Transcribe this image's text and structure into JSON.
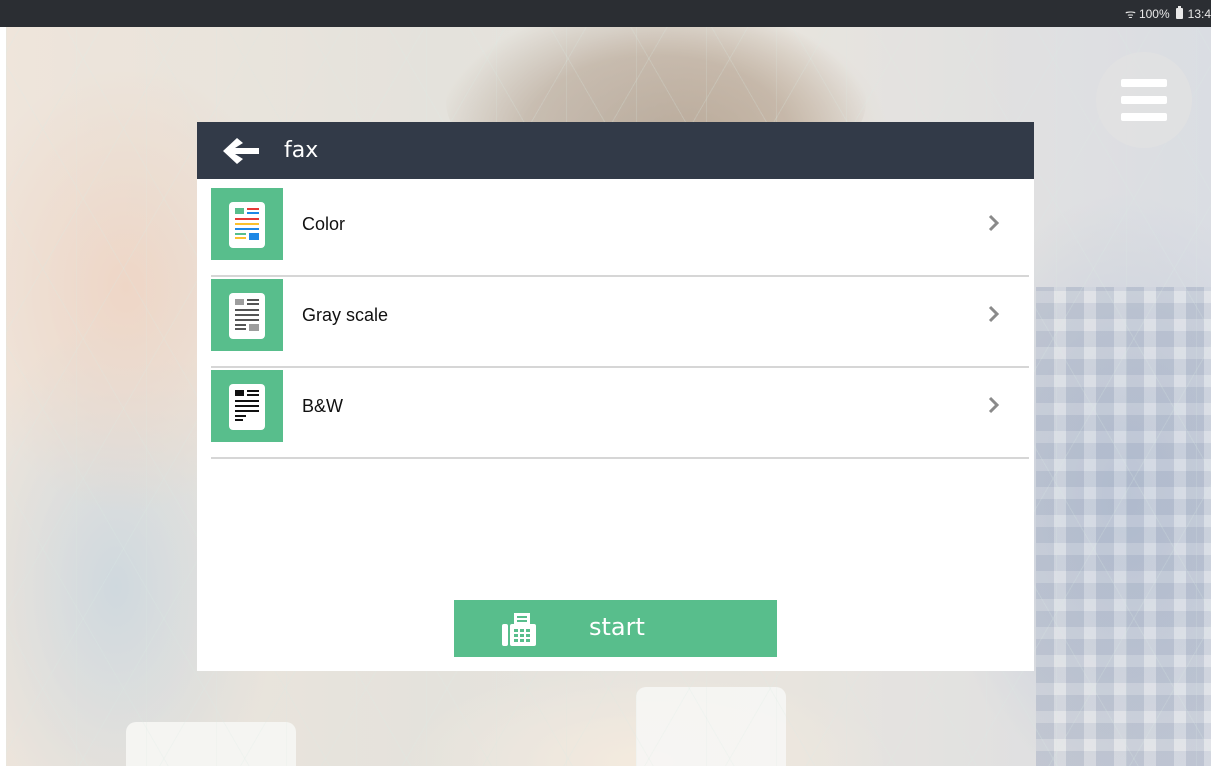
{
  "status_bar": {
    "wifi_icon": "wifi-icon",
    "battery_percent": "100%",
    "battery_icon": "battery-icon",
    "time": "13:4"
  },
  "menu": {
    "icon": "hamburger-menu-icon"
  },
  "dialog": {
    "back_icon": "arrow-left-icon",
    "title": "fax",
    "options": [
      {
        "label": "Color",
        "icon": "color-document-icon"
      },
      {
        "label": "Gray scale",
        "icon": "grayscale-document-icon"
      },
      {
        "label": "B&W",
        "icon": "bw-document-icon"
      }
    ],
    "start_button": {
      "label": "start",
      "icon": "fax-machine-icon"
    }
  },
  "colors": {
    "header": "#323a48",
    "accent_green": "#58be8c",
    "status_bar": "#2b2e33",
    "divider": "#d6d6d6"
  }
}
